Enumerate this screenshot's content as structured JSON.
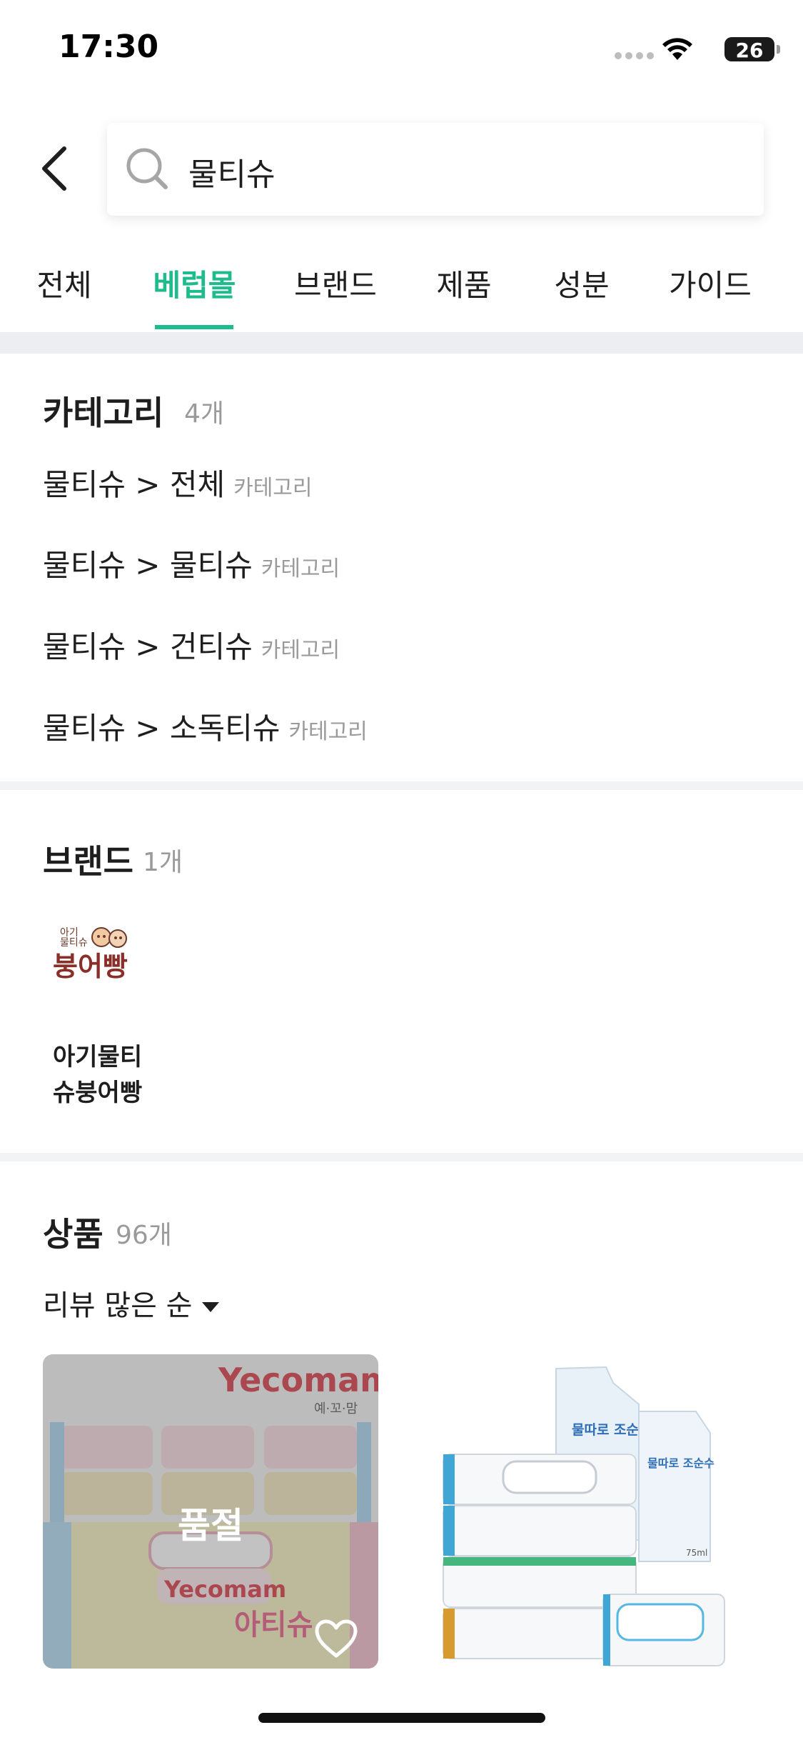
{
  "status_bar": {
    "time": "17:30",
    "battery": "26"
  },
  "header": {
    "search_value": "물티슈"
  },
  "tabs": [
    {
      "label": "전체",
      "active": false
    },
    {
      "label": "베럽몰",
      "active": true
    },
    {
      "label": "브랜드",
      "active": false
    },
    {
      "label": "제품",
      "active": false
    },
    {
      "label": "성분",
      "active": false
    },
    {
      "label": "가이드",
      "active": false
    }
  ],
  "category_section": {
    "title": "카테고리",
    "count": "4개",
    "items": [
      {
        "label": "물티슈 > 전체",
        "tag": "카테고리"
      },
      {
        "label": "물티슈 > 물티슈",
        "tag": "카테고리"
      },
      {
        "label": "물티슈 > 건티슈",
        "tag": "카테고리"
      },
      {
        "label": "물티슈 > 소독티슈",
        "tag": "카테고리"
      }
    ]
  },
  "brand_section": {
    "title": "브랜드",
    "count": "1개",
    "brand": {
      "logo_small": "아기\n물티슈",
      "logo_big": "붕어빵",
      "name": "아기물티\n슈붕어빵"
    }
  },
  "product_section": {
    "title": "상품",
    "count": "96개",
    "sort_label": "리뷰 많은 순",
    "products": [
      {
        "brand": "Yecomam",
        "brand_ko": "예·꼬·맘",
        "package_text": "아티슈",
        "soldout_label": "품절",
        "soldout": true
      },
      {
        "label_1": "물따로 조순수",
        "label_2": "물따로 조순수",
        "volume": "75ml",
        "soldout": false
      }
    ]
  },
  "colors": {
    "accent": "#1ebc8c",
    "text": "#1e1e1e",
    "muted": "#9a9a9a",
    "divider": "#eceef2"
  }
}
